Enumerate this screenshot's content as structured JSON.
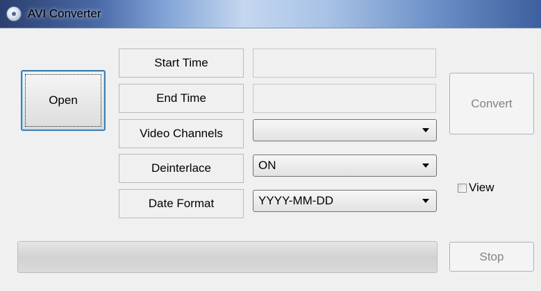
{
  "window": {
    "title": "AVI Converter"
  },
  "buttons": {
    "open": "Open",
    "convert": "Convert",
    "stop": "Stop"
  },
  "fields": {
    "start_time": {
      "label": "Start Time",
      "value": ""
    },
    "end_time": {
      "label": "End Time",
      "value": ""
    },
    "video_channels": {
      "label": "Video Channels",
      "value": ""
    },
    "deinterlace": {
      "label": "Deinterlace",
      "value": "ON"
    },
    "date_format": {
      "label": "Date Format",
      "value": "YYYY-MM-DD"
    }
  },
  "view_checkbox": {
    "label": "View",
    "checked": false
  },
  "progress": {
    "percent": 0
  }
}
